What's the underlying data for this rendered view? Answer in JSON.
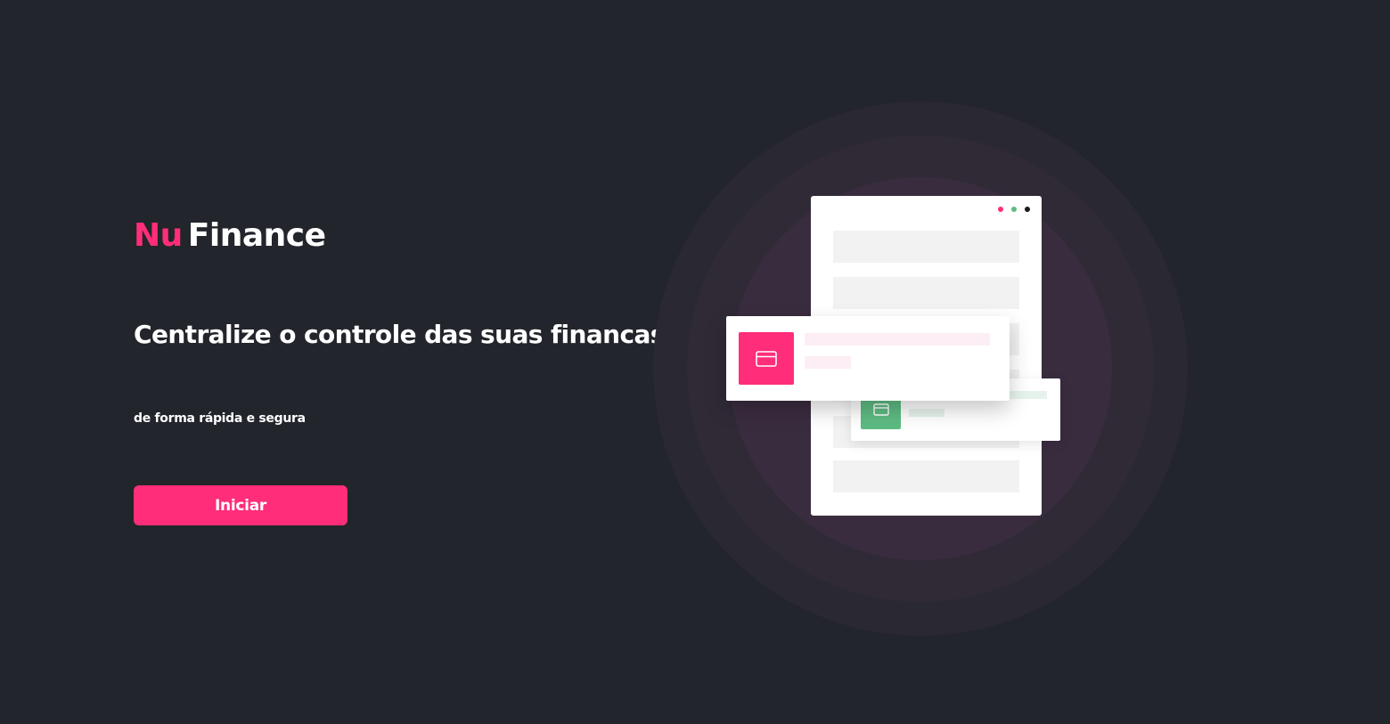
{
  "brand": {
    "name_part1": "Nu",
    "name_part2": "Finance"
  },
  "hero": {
    "headline": "Centralize o controle das suas financas",
    "subline": "de forma rápida e segura",
    "cta_label": "Iniciar"
  },
  "illustration": {
    "window_dot_colors": [
      "#ff2d7a",
      "#5dbb82",
      "#1b1b1b"
    ],
    "primary_card_icon": "credit-card-icon",
    "secondary_card_icon": "credit-card-icon"
  },
  "colors": {
    "background": "#22252b",
    "accent": "#ff2d7a",
    "secondary_accent": "#5dbb82",
    "text": "#ffffff"
  }
}
